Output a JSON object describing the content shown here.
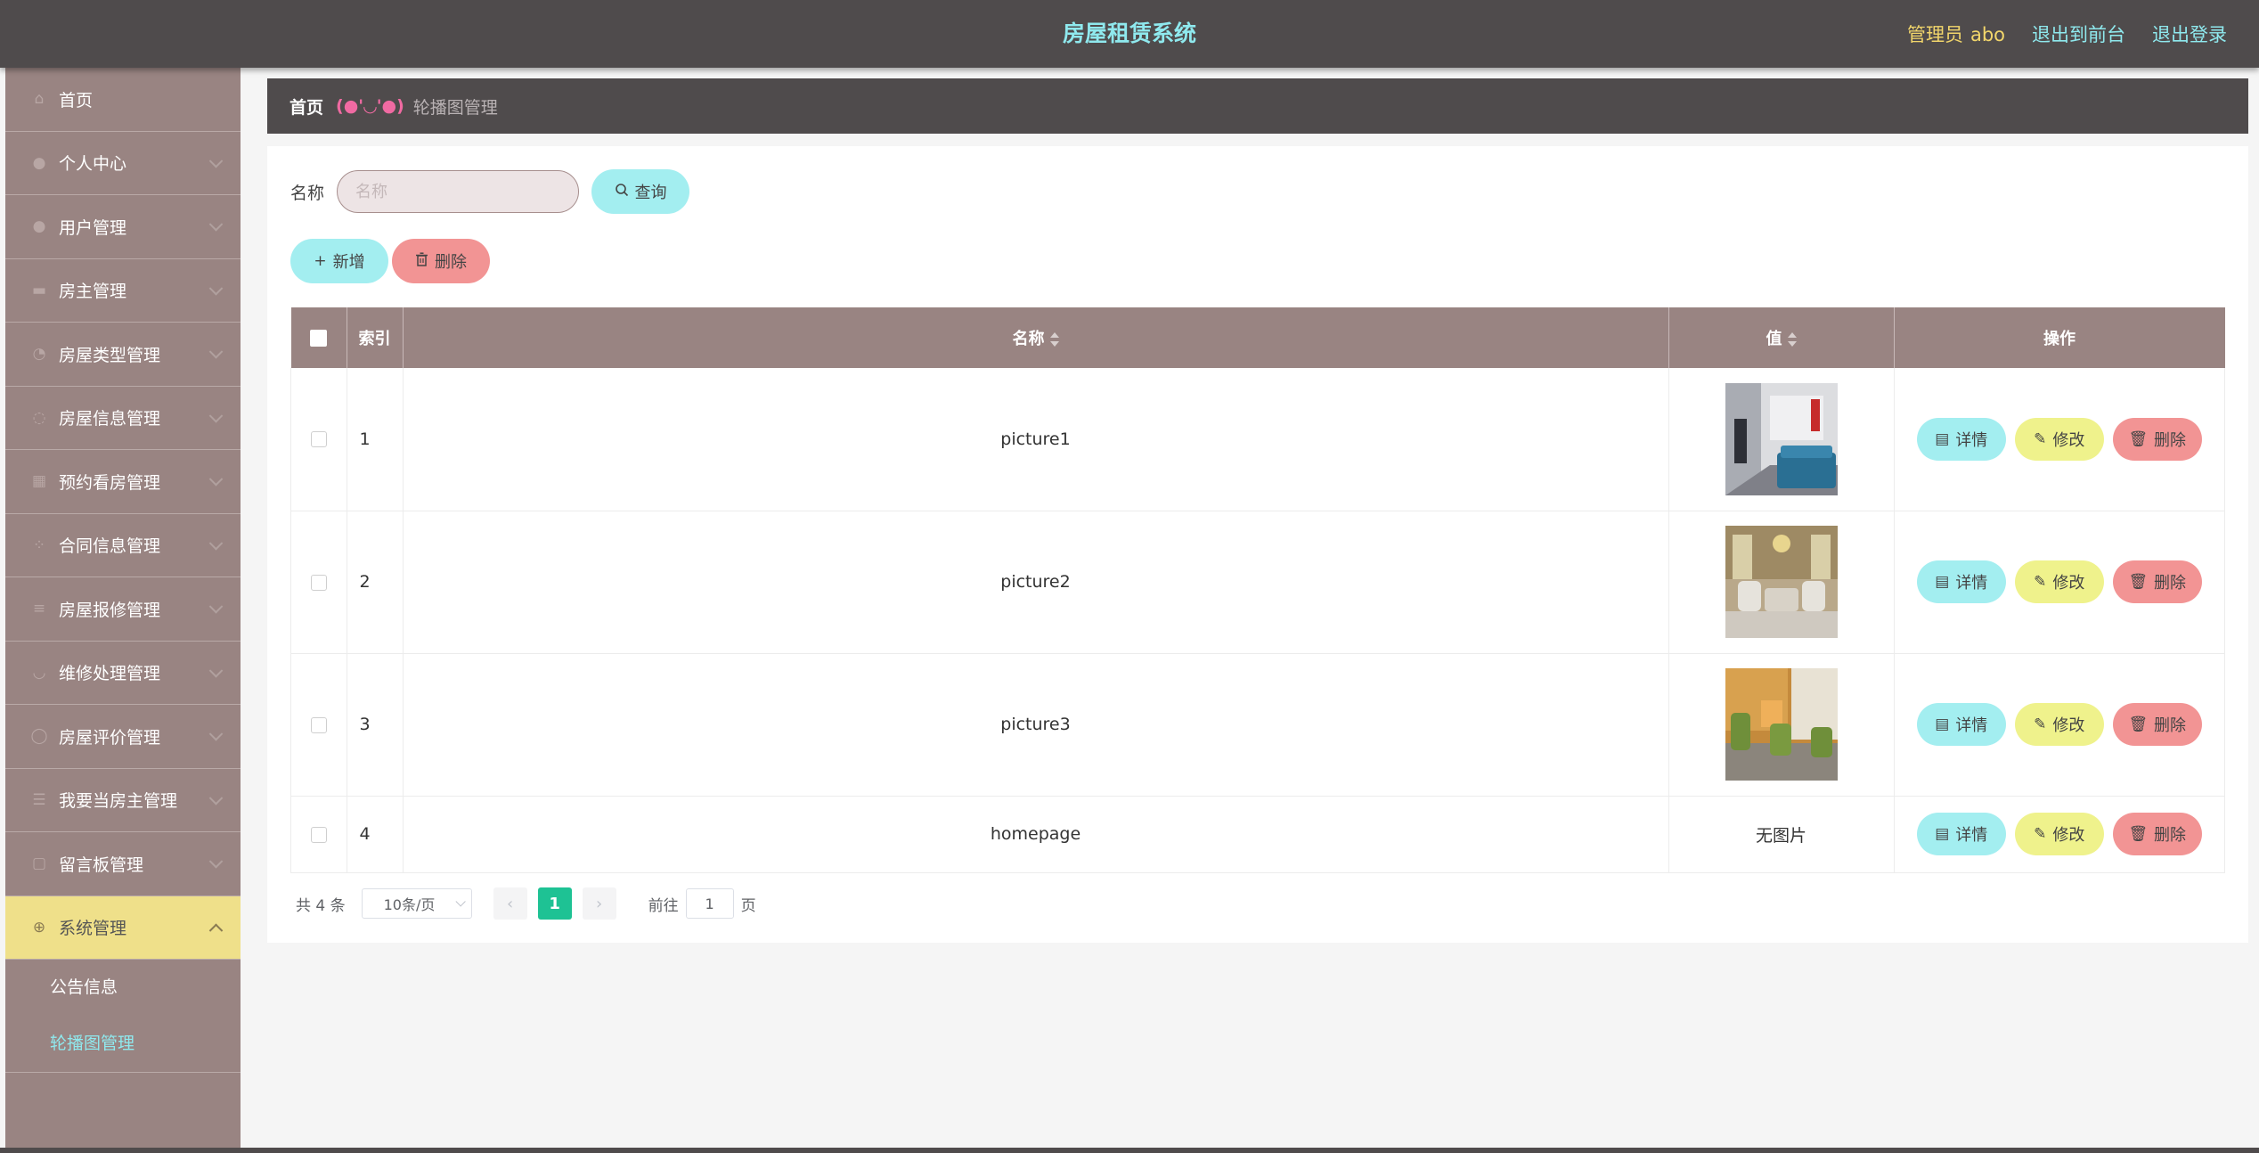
{
  "header": {
    "title": "房屋租赁系统",
    "admin_label": "管理员",
    "admin_name": "abo",
    "links": [
      "退出到前台",
      "退出登录"
    ]
  },
  "sidebar": {
    "items": [
      {
        "label": "首页",
        "icon": "home-icon"
      },
      {
        "label": "个人中心",
        "icon": "user-icon"
      },
      {
        "label": "用户管理",
        "icon": "users-icon"
      },
      {
        "label": "房主管理",
        "icon": "landlord-icon"
      },
      {
        "label": "房屋类型管理",
        "icon": "category-icon"
      },
      {
        "label": "房屋信息管理",
        "icon": "info-icon"
      },
      {
        "label": "预约看房管理",
        "icon": "calendar-icon"
      },
      {
        "label": "合同信息管理",
        "icon": "grid-icon"
      },
      {
        "label": "房屋报修管理",
        "icon": "list-icon"
      },
      {
        "label": "维修处理管理",
        "icon": "wrench-icon"
      },
      {
        "label": "房屋评价管理",
        "icon": "comment-icon"
      },
      {
        "label": "我要当房主管理",
        "icon": "menu-icon"
      },
      {
        "label": "留言板管理",
        "icon": "message-icon"
      },
      {
        "label": "系统管理",
        "icon": "settings-icon"
      }
    ],
    "submenu": [
      "公告信息",
      "轮播图管理"
    ]
  },
  "breadcrumb": {
    "home": "首页",
    "emoji": "(●'◡'●)",
    "current": "轮播图管理"
  },
  "search": {
    "label": "名称",
    "placeholder": "名称",
    "value": "",
    "button": "查询"
  },
  "actions": {
    "add": "新增",
    "delete": "删除"
  },
  "table": {
    "columns": [
      "索引",
      "名称",
      "值",
      "操作"
    ],
    "rows": [
      {
        "index": "1",
        "name": "picture1",
        "value": "",
        "thumb": "picture1"
      },
      {
        "index": "2",
        "name": "picture2",
        "value": "",
        "thumb": "picture2"
      },
      {
        "index": "3",
        "name": "picture3",
        "value": "",
        "thumb": "picture3"
      },
      {
        "index": "4",
        "name": "homepage",
        "value": "无图片",
        "thumb": ""
      }
    ],
    "row_actions": {
      "detail": "详情",
      "edit": "修改",
      "delete": "删除"
    }
  },
  "pagination": {
    "total": "共 4 条",
    "page_size": "10条/页",
    "current_page": "1",
    "goto_label": "前往",
    "goto_value": "1",
    "goto_suffix": "页"
  },
  "colors": {
    "topbar": "#4f4b4c",
    "sidebar": "#998482",
    "active_menu": "#efe08a",
    "title": "#8fe9ee",
    "admin": "#f2d66b",
    "btn_cyan": "#a3eef0",
    "btn_yellow": "#eff28c",
    "btn_red": "#f29494",
    "page_active": "#1ec294"
  }
}
